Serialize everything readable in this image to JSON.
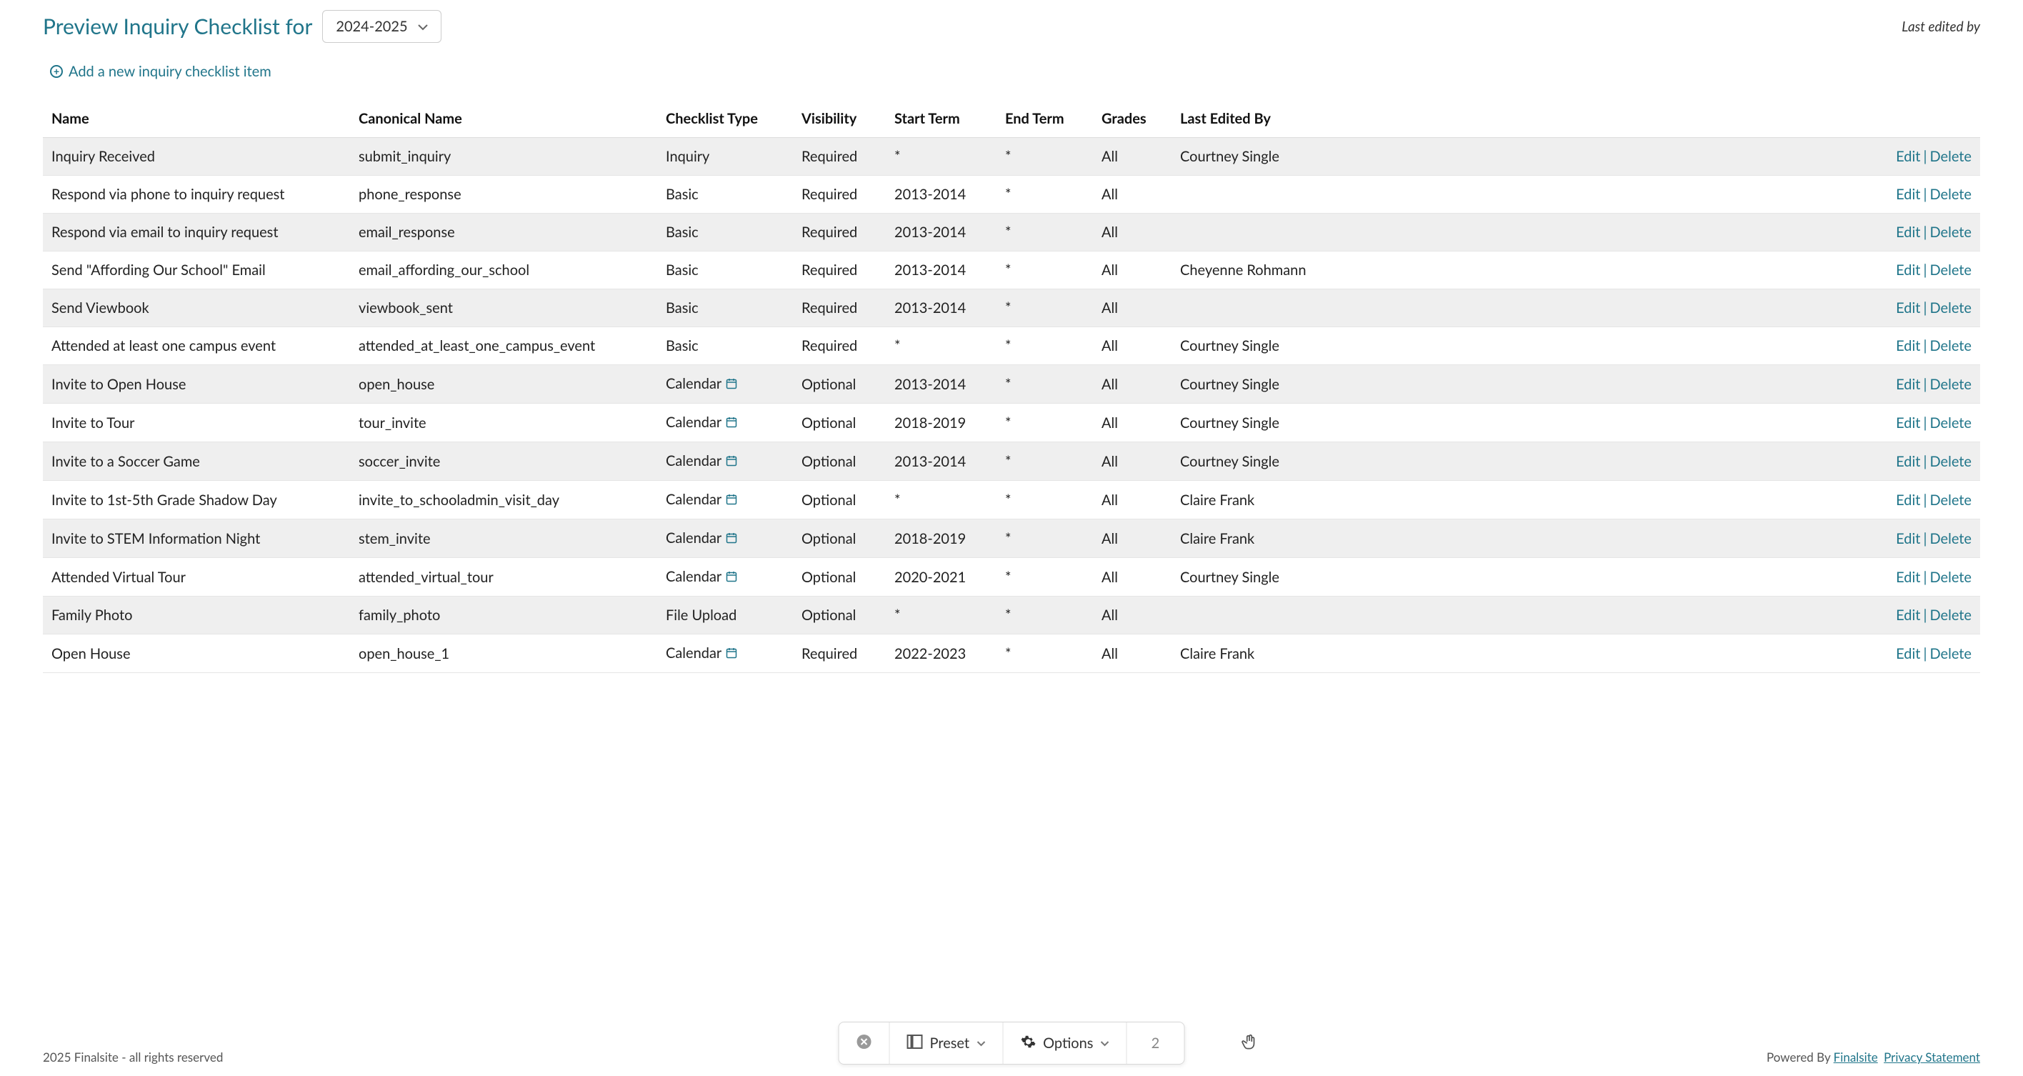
{
  "header": {
    "title_prefix": "Preview Inquiry Checklist for",
    "selected_year": "2024-2025",
    "last_edited_label": "Last edited by"
  },
  "add_link_label": "Add a new inquiry checklist item",
  "columns": {
    "name": "Name",
    "canonical": "Canonical Name",
    "type": "Checklist Type",
    "visibility": "Visibility",
    "start": "Start Term",
    "end": "End Term",
    "grades": "Grades",
    "last_edited_by": "Last Edited By"
  },
  "actions": {
    "edit": "Edit",
    "delete": "Delete"
  },
  "rows": [
    {
      "name": "Inquiry Received",
      "canonical": "submit_inquiry",
      "type": "Inquiry",
      "has_cal": false,
      "visibility": "Required",
      "start": "*",
      "end": "*",
      "grades": "All",
      "editor": "Courtney Single"
    },
    {
      "name": "Respond via phone to inquiry request",
      "canonical": "phone_response",
      "type": "Basic",
      "has_cal": false,
      "visibility": "Required",
      "start": "2013-2014",
      "end": "*",
      "grades": "All",
      "editor": ""
    },
    {
      "name": "Respond via email to inquiry request",
      "canonical": "email_response",
      "type": "Basic",
      "has_cal": false,
      "visibility": "Required",
      "start": "2013-2014",
      "end": "*",
      "grades": "All",
      "editor": ""
    },
    {
      "name": "Send \"Affording Our School\" Email",
      "canonical": "email_affording_our_school",
      "type": "Basic",
      "has_cal": false,
      "visibility": "Required",
      "start": "2013-2014",
      "end": "*",
      "grades": "All",
      "editor": "Cheyenne Rohmann"
    },
    {
      "name": "Send Viewbook",
      "canonical": "viewbook_sent",
      "type": "Basic",
      "has_cal": false,
      "visibility": "Required",
      "start": "2013-2014",
      "end": "*",
      "grades": "All",
      "editor": ""
    },
    {
      "name": "Attended at least one campus event",
      "canonical": "attended_at_least_one_campus_event",
      "type": "Basic",
      "has_cal": false,
      "visibility": "Required",
      "start": "*",
      "end": "*",
      "grades": "All",
      "editor": "Courtney Single"
    },
    {
      "name": "Invite to Open House",
      "canonical": "open_house",
      "type": "Calendar",
      "has_cal": true,
      "visibility": "Optional",
      "start": "2013-2014",
      "end": "*",
      "grades": "All",
      "editor": "Courtney Single"
    },
    {
      "name": "Invite to Tour",
      "canonical": "tour_invite",
      "type": "Calendar",
      "has_cal": true,
      "visibility": "Optional",
      "start": "2018-2019",
      "end": "*",
      "grades": "All",
      "editor": "Courtney Single"
    },
    {
      "name": "Invite to a Soccer Game",
      "canonical": "soccer_invite",
      "type": "Calendar",
      "has_cal": true,
      "visibility": "Optional",
      "start": "2013-2014",
      "end": "*",
      "grades": "All",
      "editor": "Courtney Single"
    },
    {
      "name": "Invite to 1st-5th Grade Shadow Day",
      "canonical": "invite_to_schooladmin_visit_day",
      "type": "Calendar",
      "has_cal": true,
      "visibility": "Optional",
      "start": "*",
      "end": "*",
      "grades": "All",
      "editor": "Claire Frank"
    },
    {
      "name": "Invite to STEM Information Night",
      "canonical": "stem_invite",
      "type": "Calendar",
      "has_cal": true,
      "visibility": "Optional",
      "start": "2018-2019",
      "end": "*",
      "grades": "All",
      "editor": "Claire Frank"
    },
    {
      "name": "Attended Virtual Tour",
      "canonical": "attended_virtual_tour",
      "type": "Calendar",
      "has_cal": true,
      "visibility": "Optional",
      "start": "2020-2021",
      "end": "*",
      "grades": "All",
      "editor": "Courtney Single"
    },
    {
      "name": "Family Photo",
      "canonical": "family_photo",
      "type": "File Upload",
      "has_cal": false,
      "visibility": "Optional",
      "start": "*",
      "end": "*",
      "grades": "All",
      "editor": ""
    },
    {
      "name": "Open House",
      "canonical": "open_house_1",
      "type": "Calendar",
      "has_cal": true,
      "visibility": "Required",
      "start": "2022-2023",
      "end": "*",
      "grades": "All",
      "editor": "Claire Frank"
    }
  ],
  "footer": {
    "copyright": "2025 Finalsite - all rights reserved",
    "powered_prefix": "Powered By ",
    "powered_link": "Finalsite",
    "privacy_link": "Privacy Statement"
  },
  "toolbar": {
    "preset": "Preset",
    "options": "Options",
    "page": "2"
  }
}
